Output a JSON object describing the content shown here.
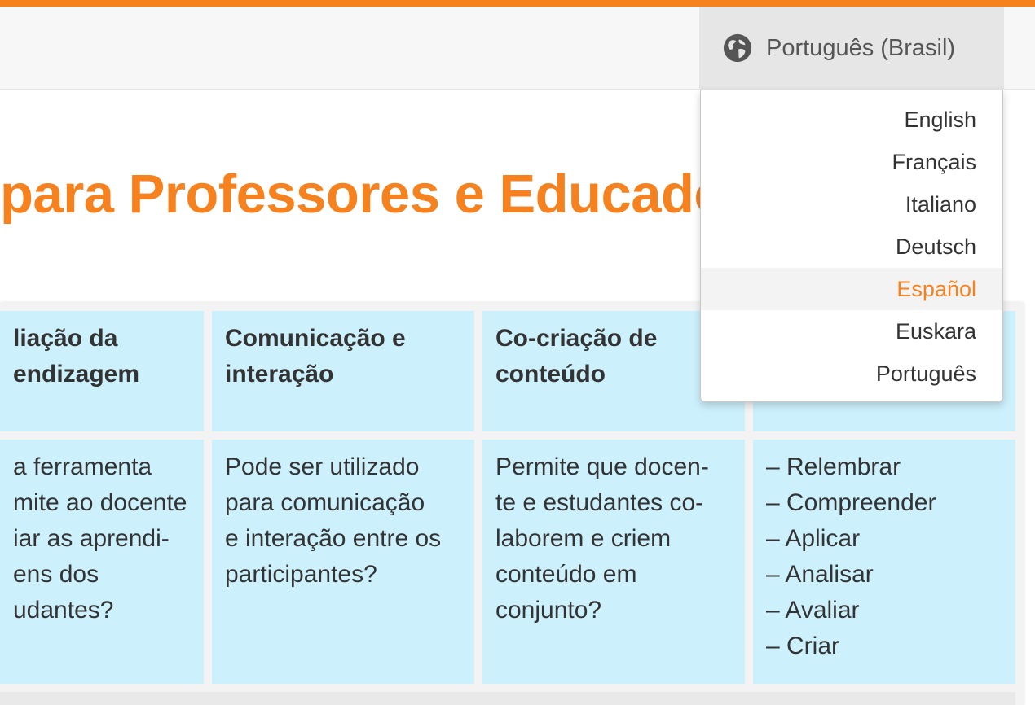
{
  "header": {
    "language_selector": {
      "icon": "globe-icon",
      "label": "Português (Brasil)"
    }
  },
  "main": {
    "title": "para Professores e Educado"
  },
  "table": {
    "headers": [
      [
        "liação da",
        "endizagem"
      ],
      [
        "Comunicação e",
        "interação"
      ],
      [
        "Co-criação de",
        "conteúdo"
      ],
      []
    ],
    "body": [
      [
        "a ferramenta",
        "mite ao docente",
        "iar as aprendi-",
        "ens dos",
        "udantes?"
      ],
      [
        "Pode ser utilizado",
        "para comunicação",
        "e interação entre os",
        "participantes?"
      ],
      [
        "Permite que docen-",
        "te e estudantes co-",
        "laborem e criem",
        "conteúdo em",
        "conjunto?"
      ],
      [
        "–  Relembrar",
        "–  Compreender",
        "–  Aplicar",
        "–  Analisar",
        "–  Avaliar",
        "–  Criar"
      ]
    ]
  },
  "language_menu": {
    "items": [
      "English",
      "Français",
      "Italiano",
      "Deutsch",
      "Español",
      "Euskara",
      "Português"
    ],
    "highlighted": "Español"
  },
  "colors": {
    "accent": "#f5821f",
    "cell_bg": "#ccf0fc",
    "header_bg": "#f7f7f7"
  }
}
